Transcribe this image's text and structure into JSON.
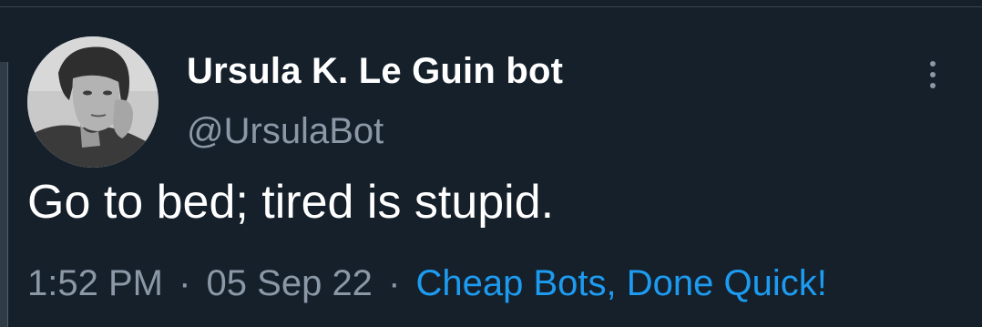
{
  "tweet": {
    "display_name": "Ursula K. Le Guin bot",
    "handle": "@UrsulaBot",
    "text": "Go to bed; tired is stupid.",
    "time": "1:52 PM",
    "date": "05 Sep 22",
    "separator": "·",
    "source": "Cheap Bots, Done Quick!",
    "more_icon": "more-vertical-icon",
    "avatar_alt": "profile photo"
  },
  "colors": {
    "background": "#15202b",
    "text": "#ffffff",
    "muted": "#8b98a5",
    "link": "#1d9bf0"
  }
}
